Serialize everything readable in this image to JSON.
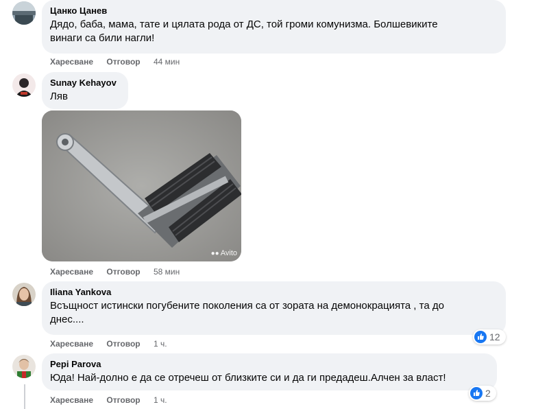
{
  "comments": [
    {
      "author": "Цанко Цанев",
      "text_line1": "Дядо, баба, мама, тате и цялата рода от ДС, той громи комунизма. Болшевиките",
      "text_line2": "винаги са били нагли!",
      "like_label": "Харесване",
      "reply_label": "Отговор",
      "time": "44 мин"
    },
    {
      "author": "Sunay Kehayov",
      "text_line1": "Ляв",
      "photo_watermark": "Avito",
      "like_label": "Харесване",
      "reply_label": "Отговор",
      "time": "58 мин"
    },
    {
      "author": "Iliana Yankova",
      "text_line1": "Всъщност истински погубените поколения са от зората на демонокрацията , та до",
      "text_line2": "днес....",
      "like_label": "Харесване",
      "reply_label": "Отговор",
      "time": "1 ч.",
      "reaction_icon": "like-icon",
      "reaction_count": "12"
    },
    {
      "author": "Pepi Parova",
      "text_line1": "Юда! Най-долно е да се отречеш от близките си и да ги предадеш.Алчен за власт!",
      "like_label": "Харесване",
      "reply_label": "Отговор",
      "time": "1 ч.",
      "reaction_icon": "like-icon",
      "reaction_count": "2"
    }
  ],
  "colors": {
    "bubble": "#f0f2f5",
    "meta_text": "#65676b",
    "like_blue": "#1877f2"
  }
}
